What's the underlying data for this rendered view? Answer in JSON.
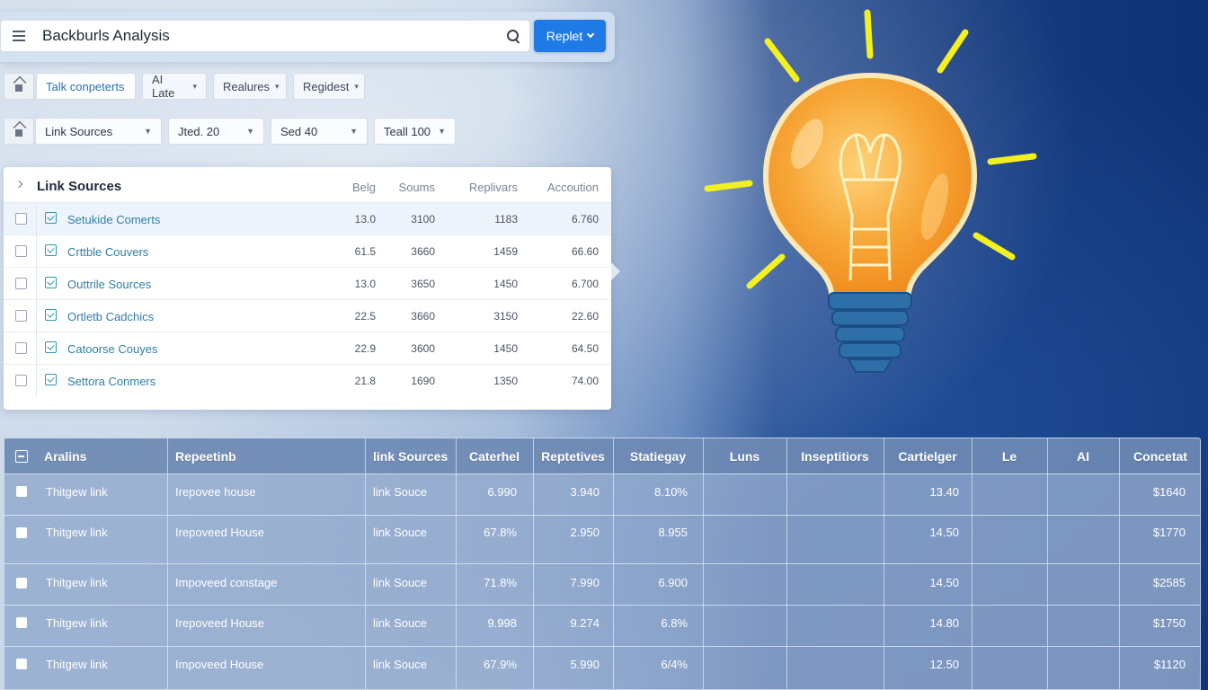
{
  "search": {
    "value": "Backburls Analysis",
    "button_label": "Replet"
  },
  "filters_row1": [
    {
      "label": "Talk conpeterts"
    },
    {
      "label": "AI Late"
    },
    {
      "label": "Realures"
    },
    {
      "label": "Regidest"
    }
  ],
  "filters_row2": [
    {
      "label": "Link Sources"
    },
    {
      "label": "Jted. 20"
    },
    {
      "label": "Sed 40"
    },
    {
      "label": "Teall 100"
    }
  ],
  "upper_table": {
    "title": "Link Sources",
    "columns": [
      "Belg",
      "Soums",
      "Replivars",
      "Accoution"
    ],
    "rows": [
      {
        "name": "Setukide Comerts",
        "c1": "13.0",
        "c2": "3100",
        "c3": "1183",
        "c4": "6.760"
      },
      {
        "name": "Crttble Couvers",
        "c1": "61.5",
        "c2": "3660",
        "c3": "1459",
        "c4": "66.60"
      },
      {
        "name": "Outtrile Sources",
        "c1": "13.0",
        "c2": "3650",
        "c3": "1450",
        "c4": "6.700"
      },
      {
        "name": "Ortletb Cadchics",
        "c1": "22.5",
        "c2": "3660",
        "c3": "3150",
        "c4": "22.60"
      },
      {
        "name": "Catoorse Couyes",
        "c1": "22.9",
        "c2": "3600",
        "c3": "1450",
        "c4": "64.50"
      },
      {
        "name": "Settora Conmers",
        "c1": "21.8",
        "c2": "1690",
        "c3": "1350",
        "c4": "74.00"
      }
    ]
  },
  "bottom_table": {
    "columns": [
      "Aralins",
      "Repeetinb",
      "link Sources",
      "Caterhel",
      "Reptetives",
      "Statiegay",
      "Luns",
      "Inseptitiors",
      "Cartielger",
      "Le",
      "AI",
      "Concetat"
    ],
    "rows": [
      {
        "a": "Thitgew link",
        "b": "Irepovee house",
        "c": "link Souce",
        "d": "6.990",
        "e": "3.940",
        "f": "8.10%",
        "g": "",
        "h": "",
        "i": "13.40",
        "j": "",
        "k": "",
        "l": "$1640"
      },
      {
        "a": "Thitgew link",
        "b": "Irepoveed House",
        "c": "link Souce",
        "d": "67.8%",
        "e": "2.950",
        "f": "8.955",
        "g": "",
        "h": "",
        "i": "14.50",
        "j": "",
        "k": "",
        "l": "$1770"
      },
      {
        "a": "Thitgew link",
        "b": "Impoveed constage",
        "c": "link Souce",
        "d": "71.8%",
        "e": "7.990",
        "f": "6.900",
        "g": "",
        "h": "",
        "i": "14.50",
        "j": "",
        "k": "",
        "l": "$2585"
      },
      {
        "a": "Thitgew link",
        "b": "Irepoveed House",
        "c": "link Souce",
        "d": "9.998",
        "e": "9.274",
        "f": "6.8%",
        "g": "",
        "h": "",
        "i": "14.80",
        "j": "",
        "k": "",
        "l": "$1750"
      },
      {
        "a": "Thitgew link",
        "b": "Impoveed House",
        "c": "link Souce",
        "d": "67.9%",
        "e": "5.990",
        "f": "6/4%",
        "g": "",
        "h": "",
        "i": "12.50",
        "j": "",
        "k": "",
        "l": "$1120"
      }
    ]
  },
  "colors": {
    "accent": "#1f7ae6",
    "link": "#2f7fa6",
    "bulb_orange": "#f5a32a",
    "ray_yellow": "#f3f020",
    "bulb_base": "#2f6fa8",
    "background_blue": "#0f3275"
  },
  "icons": [
    "menu-icon",
    "search-icon",
    "chevron-down-icon",
    "home-icon",
    "chevron-right-icon",
    "checkbox-icon",
    "lightbulb-illustration"
  ]
}
